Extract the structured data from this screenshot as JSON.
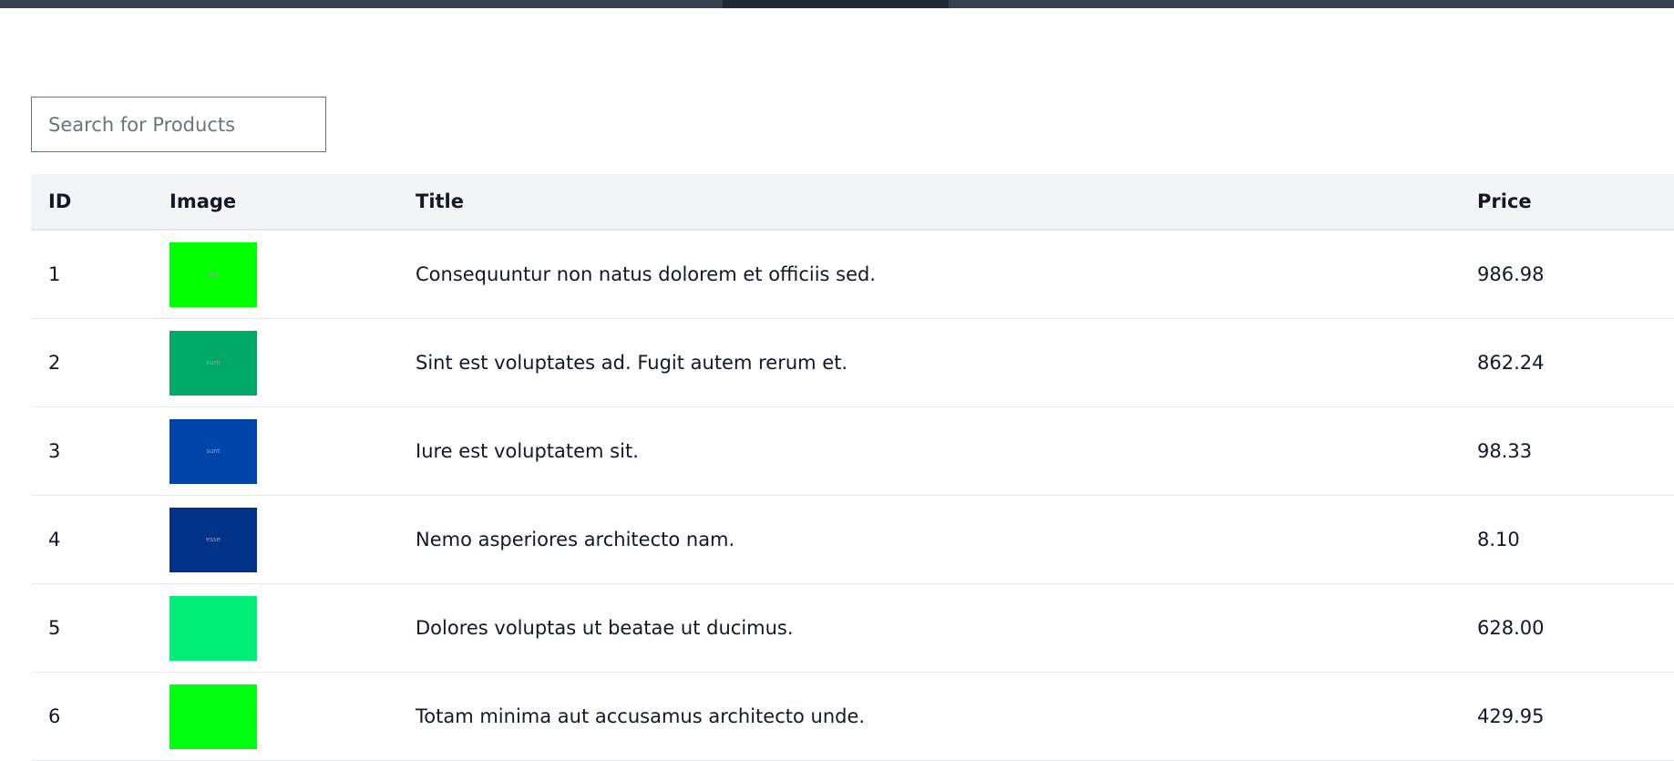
{
  "search": {
    "placeholder": "Search for Products"
  },
  "table": {
    "headers": {
      "id": "ID",
      "image": "Image",
      "title": "Title",
      "price": "Price"
    },
    "rows": [
      {
        "id": "1",
        "image_text": "sed",
        "image_color": "#00ff00",
        "title": "Consequuntur non natus dolorem et officiis sed.",
        "price": "986.98"
      },
      {
        "id": "2",
        "image_text": "eum",
        "image_color": "#00aa66",
        "title": "Sint est voluptates ad. Fugit autem rerum et.",
        "price": "862.24"
      },
      {
        "id": "3",
        "image_text": "sunt",
        "image_color": "#0044aa",
        "title": "Iure est voluptatem sit.",
        "price": "98.33"
      },
      {
        "id": "4",
        "image_text": "esse",
        "image_color": "#003388",
        "title": "Nemo asperiores architecto nam.",
        "price": "8.10"
      },
      {
        "id": "5",
        "image_text": "",
        "image_color": "#00ee77",
        "title": "Dolores voluptas ut beatae ut ducimus.",
        "price": "628.00"
      },
      {
        "id": "6",
        "image_text": "",
        "image_color": "#00ff11",
        "title": "Totam minima aut accusamus architecto unde.",
        "price": "429.95"
      }
    ]
  }
}
